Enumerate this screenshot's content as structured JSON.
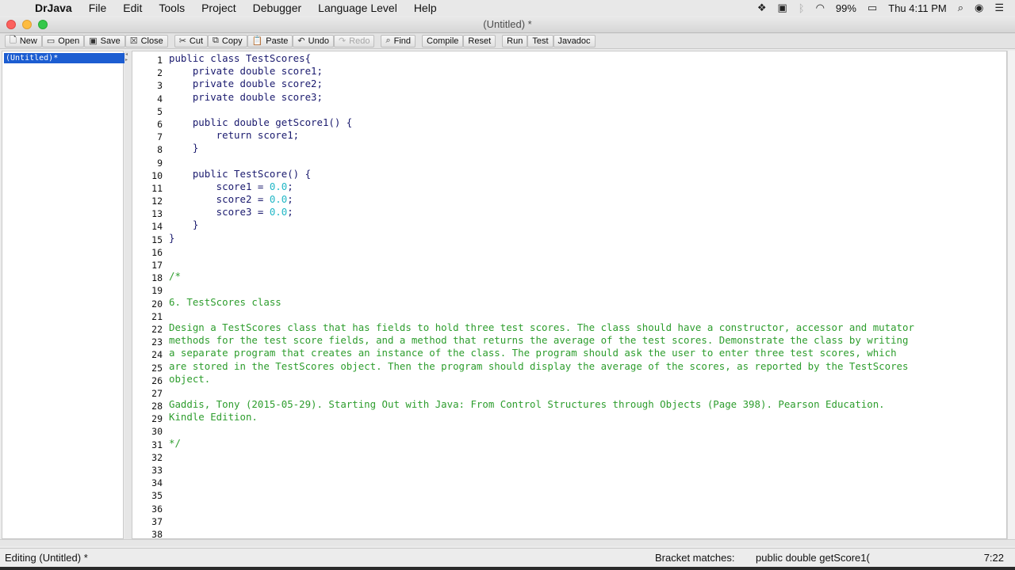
{
  "menubar": {
    "apple": "",
    "app_name": "DrJava",
    "items": [
      "File",
      "Edit",
      "Tools",
      "Project",
      "Debugger",
      "Language Level",
      "Help"
    ],
    "battery": "99%",
    "clock": "Thu 4:11 PM"
  },
  "window": {
    "title": "(Untitled) *"
  },
  "toolbar": {
    "buttons": [
      {
        "label": "New",
        "icon": "new-file-icon"
      },
      {
        "label": "Open",
        "icon": "open-folder-icon"
      },
      {
        "label": "Save",
        "icon": "save-icon"
      },
      {
        "label": "Close",
        "icon": "close-doc-icon"
      },
      {
        "label": "Cut",
        "icon": "scissors-icon"
      },
      {
        "label": "Copy",
        "icon": "copy-icon"
      },
      {
        "label": "Paste",
        "icon": "paste-icon"
      },
      {
        "label": "Undo",
        "icon": "undo-icon"
      },
      {
        "label": "Redo",
        "icon": "redo-icon",
        "disabled": true
      },
      {
        "label": "Find",
        "icon": "binoculars-icon"
      },
      {
        "label": "Compile"
      },
      {
        "label": "Reset"
      },
      {
        "label": "Run"
      },
      {
        "label": "Test"
      },
      {
        "label": "Javadoc"
      }
    ]
  },
  "documents": {
    "selected": "(Untitled)*"
  },
  "editor": {
    "line_numbers": [
      "1",
      "2",
      "3",
      "4",
      "5",
      "6",
      "7",
      "8",
      "9",
      "10",
      "11",
      "12",
      "13",
      "14",
      "15",
      "16",
      "17",
      "18",
      "19",
      "20",
      "21",
      "22",
      "23",
      "24",
      "25",
      "26",
      "27",
      "28",
      "29",
      "30",
      "31",
      "32",
      "33",
      "34",
      "35",
      "36",
      "37",
      "38"
    ],
    "code_lines": [
      [
        {
          "t": "public class TestScores{"
        }
      ],
      [
        {
          "t": "    private double score1;"
        }
      ],
      [
        {
          "t": "    private double score2;"
        }
      ],
      [
        {
          "t": "    private double score3;"
        }
      ],
      [
        {
          "t": ""
        }
      ],
      [
        {
          "t": "    public double getScore1() {"
        }
      ],
      [
        {
          "t": "        return score1;"
        }
      ],
      [
        {
          "t": "    }"
        }
      ],
      [
        {
          "t": ""
        }
      ],
      [
        {
          "t": "    public TestScore() {"
        }
      ],
      [
        {
          "t": "        score1 = "
        },
        {
          "t": "0.0",
          "k": "n"
        },
        {
          "t": ";"
        }
      ],
      [
        {
          "t": "        score2 = "
        },
        {
          "t": "0.0",
          "k": "n"
        },
        {
          "t": ";"
        }
      ],
      [
        {
          "t": "        score3 = "
        },
        {
          "t": "0.0",
          "k": "n"
        },
        {
          "t": ";"
        }
      ],
      [
        {
          "t": "    }"
        }
      ],
      [
        {
          "t": "}"
        }
      ],
      [
        {
          "t": ""
        }
      ],
      [
        {
          "t": ""
        }
      ],
      [
        {
          "t": "/*",
          "k": "c"
        }
      ],
      [
        {
          "t": "",
          "k": "c"
        }
      ],
      [
        {
          "t": "6. TestScores class",
          "k": "c"
        }
      ],
      [
        {
          "t": "",
          "k": "c"
        }
      ],
      [
        {
          "t": "Design a TestScores class that has fields to hold three test scores. The class should have a constructor, accessor and mutator",
          "k": "c"
        }
      ],
      [
        {
          "t": "methods for the test score fields, and a method that returns the average of the test scores. Demonstrate the class by writing",
          "k": "c"
        }
      ],
      [
        {
          "t": "a separate program that creates an instance of the class. The program should ask the user to enter three test scores, which",
          "k": "c"
        }
      ],
      [
        {
          "t": "are stored in the TestScores object. Then the program should display the average of the scores, as reported by the TestScores",
          "k": "c"
        }
      ],
      [
        {
          "t": "object.",
          "k": "c"
        }
      ],
      [
        {
          "t": "",
          "k": "c"
        }
      ],
      [
        {
          "t": "Gaddis, Tony (2015-05-29). Starting Out with Java: From Control Structures through Objects (Page 398). Pearson Education.",
          "k": "c"
        }
      ],
      [
        {
          "t": "Kindle Edition.",
          "k": "c"
        }
      ],
      [
        {
          "t": "",
          "k": "c"
        }
      ],
      [
        {
          "t": "*/",
          "k": "c"
        }
      ],
      [
        {
          "t": ""
        }
      ],
      [
        {
          "t": ""
        }
      ],
      [
        {
          "t": ""
        }
      ],
      [
        {
          "t": ""
        }
      ],
      [
        {
          "t": ""
        }
      ],
      [
        {
          "t": ""
        }
      ],
      [
        {
          "t": ""
        }
      ]
    ]
  },
  "status": {
    "editing": "Editing (Untitled) *",
    "bracket_label": "Bracket matches:",
    "bracket_value": "public double getScore1(",
    "position": "7:22"
  },
  "colors": {
    "code": "#1a1a6e",
    "number": "#21b7c6",
    "comment": "#2d9d2d",
    "selection": "#1c5dd1"
  }
}
